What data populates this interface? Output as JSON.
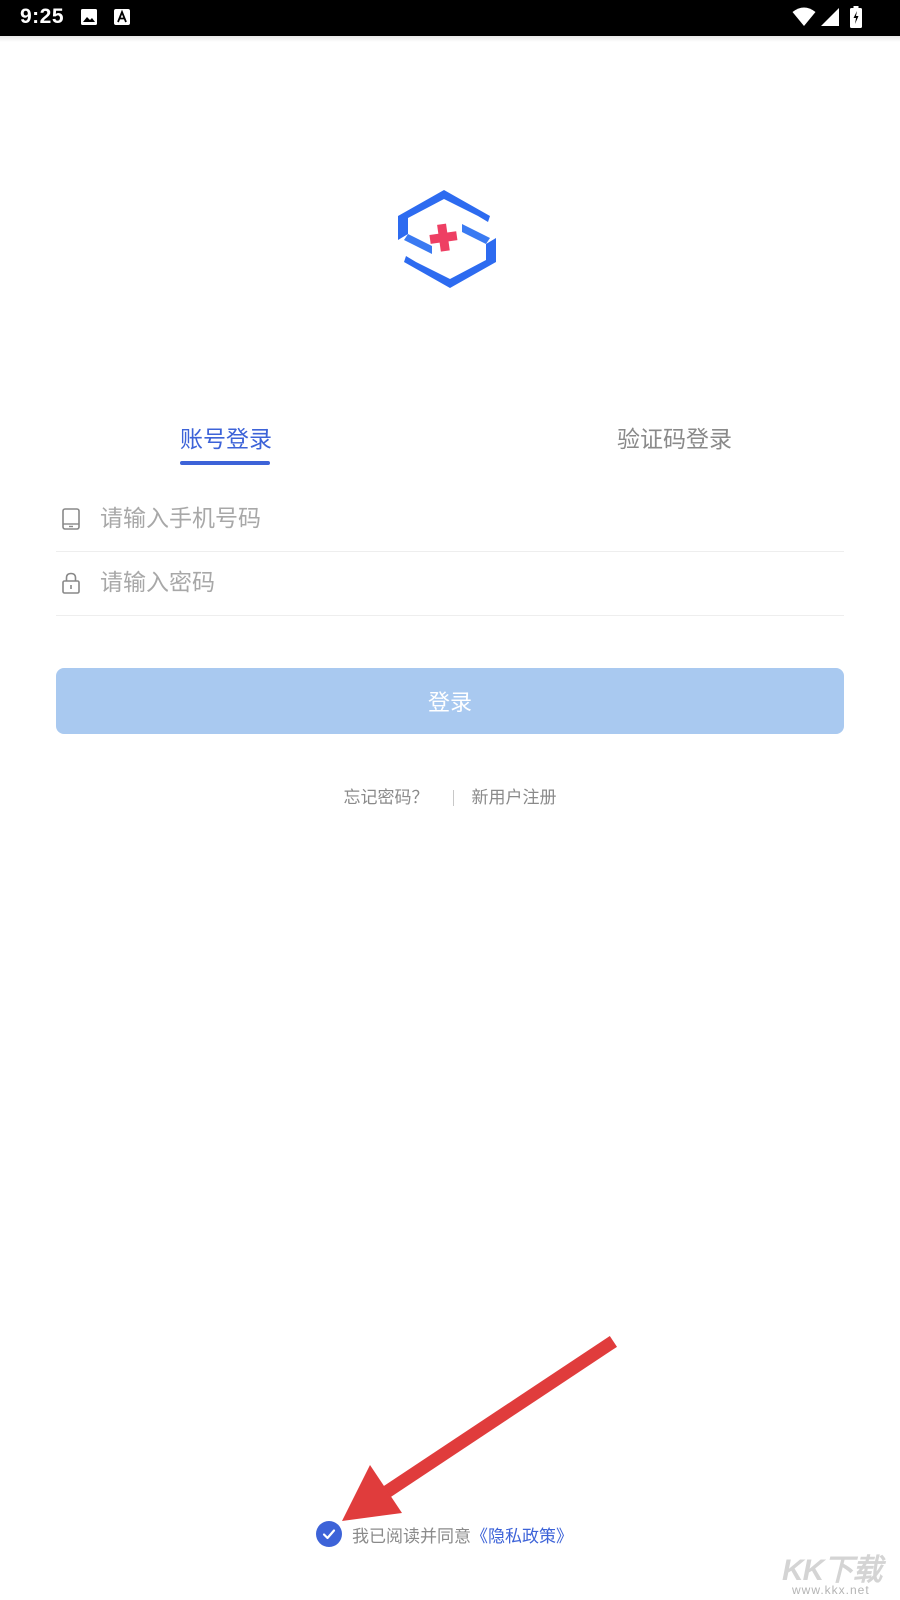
{
  "status_bar": {
    "time": "9:25",
    "icons": [
      "image-icon",
      "text-notification-icon",
      "wifi-icon",
      "signal-icon",
      "battery-icon"
    ]
  },
  "logo": {
    "name": "medical-cross-logo",
    "colors": {
      "primary": "#2d6bf0",
      "cross": "#ee3f63"
    }
  },
  "tabs": [
    {
      "label": "账号登录",
      "active": true
    },
    {
      "label": "验证码登录",
      "active": false
    }
  ],
  "inputs": {
    "phone": {
      "placeholder": "请输入手机号码",
      "value": "",
      "icon": "phone-icon"
    },
    "password": {
      "placeholder": "请输入密码",
      "value": "",
      "icon": "lock-icon"
    }
  },
  "login_button": {
    "label": "登录"
  },
  "links": {
    "forgot": "忘记密码？",
    "register": "新用户注册"
  },
  "agreement": {
    "checked": true,
    "text": "我已阅读并同意",
    "policy_link": "《隐私政策》"
  },
  "watermark": {
    "main": "KK下载",
    "sub": "www.kkx.net"
  },
  "colors": {
    "accent": "#3d63d8",
    "button_disabled": "#a9c9f0",
    "muted_text": "#8a8a8a",
    "annotation_arrow": "#e03c3c"
  }
}
